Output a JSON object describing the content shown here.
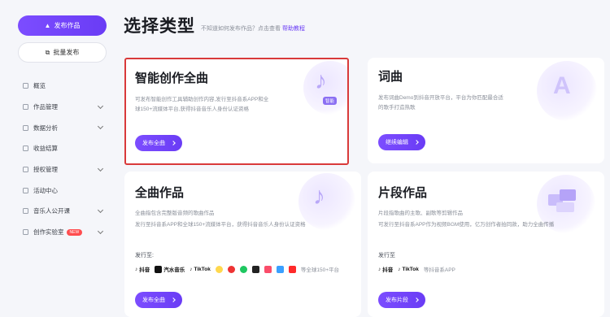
{
  "sidebar": {
    "publish_label": "发布作品",
    "batch_label": "批量发布",
    "items": [
      {
        "label": "概览",
        "chevron": false
      },
      {
        "label": "作品管理",
        "chevron": true
      },
      {
        "label": "数据分析",
        "chevron": true
      },
      {
        "label": "收益结算",
        "chevron": false
      },
      {
        "label": "授权管理",
        "chevron": true
      },
      {
        "label": "活动中心",
        "chevron": false
      },
      {
        "label": "音乐人公开课",
        "chevron": true
      },
      {
        "label": "创作实验室",
        "chevron": true,
        "badge": "NEW"
      }
    ]
  },
  "header": {
    "title": "选择类型",
    "subtitle": "不知道如何发布作品？点击查看",
    "help_link": "帮助教程"
  },
  "cards": {
    "ai": {
      "title": "智能创作全曲",
      "desc1": "可发布智能创作工具辅助创作内容,发行至抖音系APP和全",
      "desc2": "球150+流媒体平台,获得抖音音乐人身份认证资格",
      "button": "发布全曲",
      "tag": "智能"
    },
    "lyrics": {
      "title": "词曲",
      "desc1": "发布词曲Demo到抖音开放平台，平台为你匹配最合适",
      "desc2": "的歌手打造热歌",
      "button": "继续编辑"
    },
    "full": {
      "title": "全曲作品",
      "desc1": "全曲指包含完整版音频的歌曲作品",
      "desc2": "发行至抖音系APP和全球150+流媒体平台，获得抖音音乐人身份认证资格",
      "platforms_label": "发行至:",
      "platforms": [
        "抖音",
        "汽水音乐",
        "TikTok"
      ],
      "more": "等全球150+平台",
      "button": "发布全曲"
    },
    "clip": {
      "title": "片段作品",
      "desc1": "片段指歌曲的主歌、副歌等剪辑作品",
      "desc2": "可发行至抖音系APP作为视频BGM使用，亿万创作者拍同款，助力全曲传播",
      "platforms_label": "发行至",
      "platforms": [
        "抖音",
        "TikTok"
      ],
      "more": "等抖音系APP",
      "button": "发布片段"
    }
  },
  "colors": {
    "accent": "#6a3cf5",
    "selection": "#d93a3a"
  }
}
